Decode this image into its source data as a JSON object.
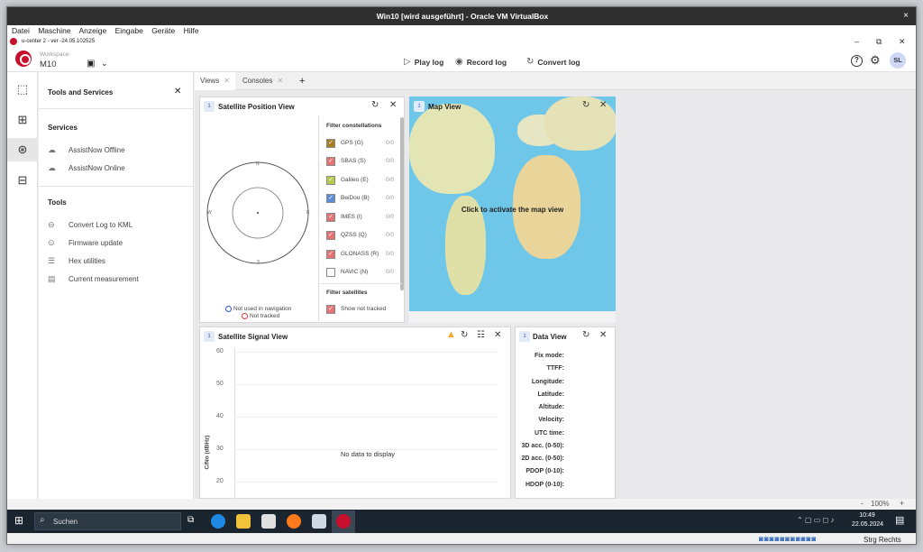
{
  "vbox": {
    "title": "Win10 [wird ausgeführt] - Oracle VM VirtualBox",
    "close": "×",
    "menu": [
      "Datei",
      "Maschine",
      "Anzeige",
      "Eingabe",
      "Geräte",
      "Hilfe"
    ],
    "host_key": "Strg Rechts"
  },
  "app": {
    "titlebar": "u-center 2 - ver -24.05.102525",
    "win_min": "–",
    "win_max": "⧉",
    "win_close": "✕",
    "workspace_label": "Workspace",
    "workspace_name": "M10",
    "chevron": "⌄",
    "play_log": "Play log",
    "record_log": "Record log",
    "convert_log": "Convert log",
    "help_icon": "?",
    "settings_icon": "⚙",
    "avatar": "SL",
    "accent": "#c8102e"
  },
  "tools_panel": {
    "title": "Tools and Services",
    "close": "✕",
    "services_heading": "Services",
    "services": [
      "AssistNow Offline",
      "AssistNow Online"
    ],
    "tools_heading": "Tools",
    "tools": [
      "Convert Log to KML",
      "Firmware update",
      "Hex utilities",
      "Current measurement"
    ]
  },
  "tabs": [
    {
      "label": "Views",
      "close": "✕"
    },
    {
      "label": "Consoles",
      "close": "✕"
    }
  ],
  "tab_add": "+",
  "satpos": {
    "num": "1",
    "title": "Satellite Position View",
    "filter_heading": "Filter constellations",
    "constellations": [
      {
        "label": "GPS (G)",
        "count": "0/0",
        "color": "#a57e1e",
        "checked": true
      },
      {
        "label": "SBAS (S)",
        "count": "0/0",
        "color": "#e57373",
        "checked": true
      },
      {
        "label": "Galileo (E)",
        "count": "0/0",
        "color": "#b5c94a",
        "checked": true
      },
      {
        "label": "BeiDou (B)",
        "count": "0/0",
        "color": "#5c8dd6",
        "checked": true
      },
      {
        "label": "IMES (I)",
        "count": "0/0",
        "color": "#e57373",
        "checked": true
      },
      {
        "label": "QZSS (Q)",
        "count": "0/0",
        "color": "#e57373",
        "checked": true
      },
      {
        "label": "GLONASS (R)",
        "count": "0/0",
        "color": "#e57373",
        "checked": true
      },
      {
        "label": "NAVIC (N)",
        "count": "0/0",
        "color": "#ffffff",
        "checked": false
      }
    ],
    "filter_sat_heading": "Filter satellites",
    "show_not_tracked": "Show not tracked",
    "legend_nav": "Not used in navigation",
    "legend_tracked": "Not tracked",
    "compass": {
      "n": "N",
      "s": "S",
      "e": "E",
      "w": "W"
    }
  },
  "map": {
    "num": "1",
    "title": "Map View",
    "activate": "Click to activate the map view"
  },
  "signal": {
    "num": "1",
    "title": "Satellite Signal View",
    "ylabel": "C/No (dBHz)",
    "yticks": [
      "60",
      "50",
      "40",
      "30",
      "20"
    ],
    "empty": "No data to display",
    "warn_color": "#f5a623"
  },
  "dataview": {
    "num": "1",
    "title": "Data View",
    "fields": [
      "Fix mode:",
      "TTFF:",
      "Longitude:",
      "Latitude:",
      "Altitude:",
      "Velocity:",
      "UTC time:",
      "3D acc. (0-50):",
      "2D acc. (0-50):",
      "PDOP (0-10):",
      "HDOP (0-10):"
    ]
  },
  "status": {
    "zoom_minus": "-",
    "zoom": "100%",
    "zoom_plus": "+"
  },
  "taskbar": {
    "search": "Suchen",
    "time": "10:49",
    "date": "22.05.2024"
  }
}
